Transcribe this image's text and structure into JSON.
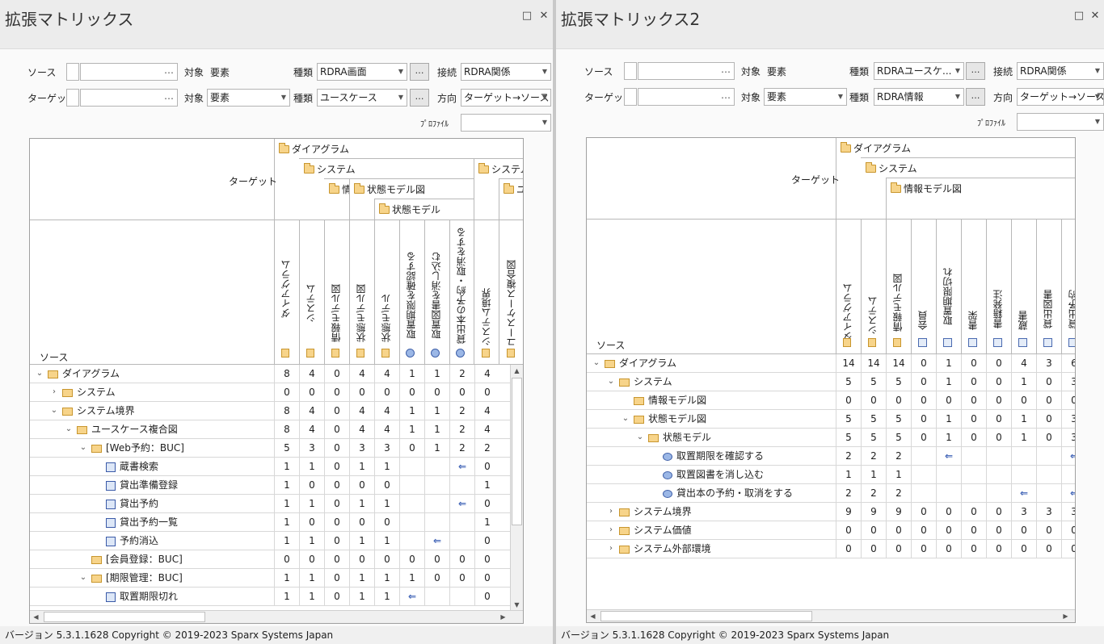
{
  "left": {
    "title": "拡張マトリックス",
    "labels": {
      "source": "ソース",
      "target": "ターゲット",
      "object": "対象",
      "kind": "種類",
      "connect": "接続",
      "direction": "方向",
      "profile": "ﾌﾟﾛﾌｧｲﾙ"
    },
    "src_object": "要素",
    "src_kind": "RDRA画面",
    "tgt_object": "要素",
    "tgt_kind": "ユースケース",
    "connect": "RDRA関係",
    "direction": "ターゲット→ソース",
    "profile": "",
    "grid_target": "ターゲット",
    "grid_source": "ソース",
    "groups": {
      "g1": "ダイアグラム",
      "g2": "システム",
      "g3": "情",
      "g4": "状態モデル図",
      "g5": "状態モデル",
      "g6": "システム",
      "g7": "ユ"
    },
    "columns": [
      "ダイアグラム",
      "システム",
      "情報モデル図",
      "状態モデル図",
      "状態モデル",
      "取置期限を確認する",
      "取置図書を消し込む",
      "貸出本の予約・取消をする",
      "システム境界",
      "ユースケース複合図"
    ],
    "rows": [
      {
        "label": "ダイアグラム",
        "cells": [
          "8",
          "4",
          "0",
          "4",
          "4",
          "1",
          "1",
          "2",
          "4"
        ]
      },
      {
        "label": "システム",
        "cells": [
          "0",
          "0",
          "0",
          "0",
          "0",
          "0",
          "0",
          "0",
          "0"
        ]
      },
      {
        "label": "システム境界",
        "cells": [
          "8",
          "4",
          "0",
          "4",
          "4",
          "1",
          "1",
          "2",
          "4"
        ]
      },
      {
        "label": "ユースケース複合図",
        "cells": [
          "8",
          "4",
          "0",
          "4",
          "4",
          "1",
          "1",
          "2",
          "4"
        ]
      },
      {
        "label": "[Web予約：BUC]",
        "cells": [
          "5",
          "3",
          "0",
          "3",
          "3",
          "0",
          "1",
          "2",
          "2"
        ]
      },
      {
        "label": "蔵書検索",
        "cells": [
          "1",
          "1",
          "0",
          "1",
          "1",
          "",
          "",
          "⇐",
          "0"
        ]
      },
      {
        "label": "貸出準備登録",
        "cells": [
          "1",
          "0",
          "0",
          "0",
          "0",
          "",
          "",
          "",
          "1"
        ]
      },
      {
        "label": "貸出予約",
        "cells": [
          "1",
          "1",
          "0",
          "1",
          "1",
          "",
          "",
          "⇐",
          "0"
        ]
      },
      {
        "label": "貸出予約一覧",
        "cells": [
          "1",
          "0",
          "0",
          "0",
          "0",
          "",
          "",
          "",
          "1"
        ]
      },
      {
        "label": "予約消込",
        "cells": [
          "1",
          "1",
          "0",
          "1",
          "1",
          "",
          "⇐",
          "",
          "0"
        ]
      },
      {
        "label": "[会員登録：BUC]",
        "cells": [
          "0",
          "0",
          "0",
          "0",
          "0",
          "0",
          "0",
          "0",
          "0"
        ]
      },
      {
        "label": "[期限管理：BUC]",
        "cells": [
          "1",
          "1",
          "0",
          "1",
          "1",
          "1",
          "0",
          "0",
          "0"
        ]
      },
      {
        "label": "取置期限切れ",
        "cells": [
          "1",
          "1",
          "0",
          "1",
          "1",
          "⇐",
          "",
          "",
          "0"
        ]
      }
    ],
    "chevrons": [
      "⌄",
      "›",
      "⌄",
      "⌄",
      "⌄",
      "",
      "",
      "",
      "",
      "",
      "",
      "⌄",
      ""
    ]
  },
  "right": {
    "title": "拡張マトリックス2",
    "labels": {
      "source": "ソース",
      "target": "ターゲット",
      "object": "対象",
      "kind": "種類",
      "connect": "接続",
      "direction": "方向",
      "profile": "ﾌﾟﾛﾌｧｲﾙ"
    },
    "src_object": "要素",
    "src_kind": "RDRAユースケ...",
    "tgt_object": "要素",
    "tgt_kind": "RDRA情報",
    "connect": "RDRA関係",
    "direction": "ターゲット→ソース",
    "profile": "",
    "grid_target": "ターゲット",
    "grid_source": "ソース",
    "groups": {
      "g1": "ダイアグラム",
      "g2": "システム",
      "g3": "情報モデル図"
    },
    "columns": [
      "ダイアグラム",
      "システム",
      "情報モデル図",
      "会員",
      "取置期限切れ",
      "書架",
      "書籍発注",
      "蔵書",
      "貸出図書",
      "貸出予約"
    ],
    "rows": [
      {
        "label": "ダイアグラム",
        "cells": [
          "14",
          "14",
          "14",
          "0",
          "1",
          "0",
          "0",
          "4",
          "3",
          "6"
        ]
      },
      {
        "label": "システム",
        "cells": [
          "5",
          "5",
          "5",
          "0",
          "1",
          "0",
          "0",
          "1",
          "0",
          "3"
        ]
      },
      {
        "label": "情報モデル図",
        "cells": [
          "0",
          "0",
          "0",
          "0",
          "0",
          "0",
          "0",
          "0",
          "0",
          "0"
        ]
      },
      {
        "label": "状態モデル図",
        "cells": [
          "5",
          "5",
          "5",
          "0",
          "1",
          "0",
          "0",
          "1",
          "0",
          "3"
        ]
      },
      {
        "label": "状態モデル",
        "cells": [
          "5",
          "5",
          "5",
          "0",
          "1",
          "0",
          "0",
          "1",
          "0",
          "3"
        ]
      },
      {
        "label": "取置期限を確認する",
        "cells": [
          "2",
          "2",
          "2",
          "",
          "⇐",
          "",
          "",
          "",
          "",
          "⇐"
        ]
      },
      {
        "label": "取置図書を消し込む",
        "cells": [
          "1",
          "1",
          "1",
          "",
          "",
          "",
          "",
          "",
          "",
          ""
        ]
      },
      {
        "label": "貸出本の予約・取消をする",
        "cells": [
          "2",
          "2",
          "2",
          "",
          "",
          "",
          "",
          "⇐",
          "",
          "⇐"
        ]
      },
      {
        "label": "システム境界",
        "cells": [
          "9",
          "9",
          "9",
          "0",
          "0",
          "0",
          "0",
          "3",
          "3",
          "3"
        ]
      },
      {
        "label": "システム価値",
        "cells": [
          "0",
          "0",
          "0",
          "0",
          "0",
          "0",
          "0",
          "0",
          "0",
          "0"
        ]
      },
      {
        "label": "システム外部環境",
        "cells": [
          "0",
          "0",
          "0",
          "0",
          "0",
          "0",
          "0",
          "0",
          "0",
          "0"
        ]
      }
    ],
    "chevrons": [
      "⌄",
      "⌄",
      "",
      "⌄",
      "⌄",
      "",
      "",
      "",
      "›",
      "›",
      "›"
    ]
  },
  "status": "バージョン 5.3.1.1628  Copyright © 2019-2023 Sparx Systems Japan"
}
